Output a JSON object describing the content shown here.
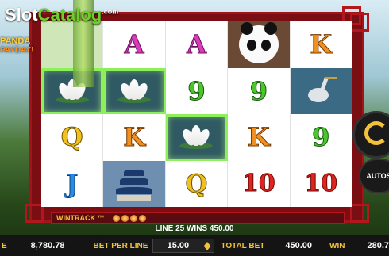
{
  "watermark": {
    "slot": "Slot",
    "catalog": "Catalog",
    "com": ".com"
  },
  "logo": {
    "line1": "PANDA",
    "line2": "PAYDAY!"
  },
  "reels": [
    [
      {
        "sym": "bamboo",
        "label": ""
      },
      {
        "sym": "A",
        "label": "A"
      },
      {
        "sym": "A",
        "label": "A"
      },
      {
        "sym": "panda",
        "label": ""
      },
      {
        "sym": "K",
        "label": "K"
      }
    ],
    [
      {
        "sym": "lotus",
        "label": "",
        "win": true
      },
      {
        "sym": "lotus",
        "label": "",
        "win": true
      },
      {
        "sym": "9",
        "label": "9"
      },
      {
        "sym": "9",
        "label": "9"
      },
      {
        "sym": "heron",
        "label": ""
      }
    ],
    [
      {
        "sym": "Q",
        "label": "Q"
      },
      {
        "sym": "K",
        "label": "K"
      },
      {
        "sym": "lotus",
        "label": "",
        "win": true
      },
      {
        "sym": "K",
        "label": "K"
      },
      {
        "sym": "9",
        "label": "9"
      }
    ],
    [
      {
        "sym": "J",
        "label": "J"
      },
      {
        "sym": "temple",
        "label": ""
      },
      {
        "sym": "Q",
        "label": "Q"
      },
      {
        "sym": "10",
        "label": "10"
      },
      {
        "sym": "10",
        "label": "10"
      }
    ]
  ],
  "wintrack": {
    "label": "WINTRACK ™"
  },
  "status": {
    "text": "LINE 25 WINS 450.00"
  },
  "bottom": {
    "balance_value": "8,780.78",
    "bet_per_line_label": "BET PER LINE",
    "bet_per_line_value": "15.00",
    "total_bet_label": "TOTAL BET",
    "total_bet_value": "450.00",
    "win_label": "WIN",
    "win_value": "280.7",
    "left_label": "E"
  },
  "buttons": {
    "autospin": "AUTOS"
  },
  "colors": {
    "frame": "#a3141a",
    "win_highlight": "#8df05a",
    "accent": "#f3c13a"
  }
}
